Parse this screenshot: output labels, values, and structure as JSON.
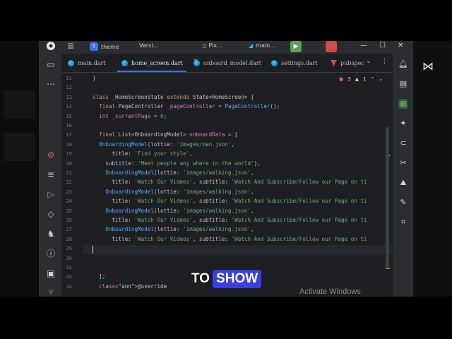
{
  "titlebar": {
    "project_badge": "T",
    "project_name": "theme",
    "vcs": "Versi…",
    "device": "Pix…",
    "config": "main…"
  },
  "tabs": [
    {
      "label": "main.dart"
    },
    {
      "label": "home_screen.dart"
    },
    {
      "label": "onboard_model.dart"
    },
    {
      "label": "settings.dart"
    },
    {
      "label": "pubspec"
    }
  ],
  "inspection": {
    "errors": "3",
    "warnings": "1"
  },
  "code_lines": [
    {
      "n": "11",
      "t": "}"
    },
    {
      "n": "12",
      "t": ""
    },
    {
      "n": "13",
      "t": "class _HomeScreenState extends State<HomeScreen> {"
    },
    {
      "n": "14",
      "t": "  final PageController _pageController = PageController();"
    },
    {
      "n": "15",
      "t": "  int _currentPage = 0;"
    },
    {
      "n": "16",
      "t": ""
    },
    {
      "n": "17",
      "t": "  final List<OnboardingModel> onboardData = ["
    },
    {
      "n": "18",
      "t": "  OnboardingModel(lottie: 'images/man.json',"
    },
    {
      "n": "19",
      "t": "      title: 'Find your style',"
    },
    {
      "n": "20",
      "t": "    subtitle: 'Meet people any where in the world'),"
    },
    {
      "n": "21",
      "t": "    OnboardingModel(lottie: 'images/walking.json',"
    },
    {
      "n": "22",
      "t": "      title: 'Watch Our Videos', subtitle: 'Watch And Subscribe/Follow our Page on ti"
    },
    {
      "n": "23",
      "t": "    OnboardingModel(lottie: 'images/walking.json',"
    },
    {
      "n": "24",
      "t": "      title: 'Watch Our Videos', subtitle: 'Watch And Subscribe/Follow our Page on ti"
    },
    {
      "n": "25",
      "t": "    OnboardingModel(lottie: 'images/walking.json',"
    },
    {
      "n": "26",
      "t": "      title: 'Watch Our Videos', subtitle: 'Watch And Subscribe/Follow our Page on ti"
    },
    {
      "n": "27",
      "t": "    OnboardingModel(lottie: 'images/walking.json',"
    },
    {
      "n": "28",
      "t": "      title: 'Watch Our Videos', subtitle: 'Watch And Subscribe/Follow our Page on ti"
    },
    {
      "n": "29",
      "t": ""
    },
    {
      "n": "30",
      "t": ""
    },
    {
      "n": "31",
      "t": ""
    },
    {
      "n": "32",
      "t": "  ];"
    },
    {
      "n": "33",
      "t": "  @override"
    }
  ],
  "caption": {
    "word1": "TO",
    "word2": "SHOW"
  },
  "watermark": "Activate Windows",
  "colors": {
    "accent": "#3574f0",
    "caption_highlight": "#3a3fe0",
    "editor_bg": "#1e1f22"
  }
}
